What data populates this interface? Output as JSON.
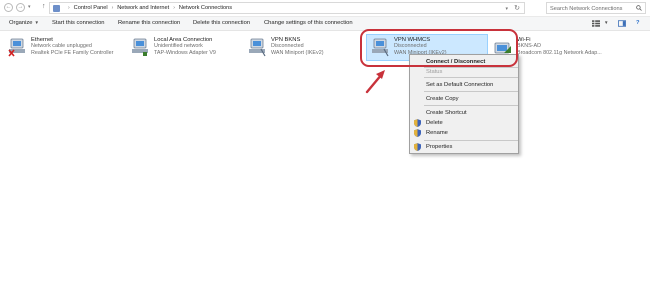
{
  "address_bar": {
    "breadcrumbs": [
      "Control Panel",
      "Network and Internet",
      "Network Connections"
    ],
    "search_placeholder": "Search Network Connections"
  },
  "toolbar": {
    "organize": "Organize",
    "start": "Start this connection",
    "rename": "Rename this connection",
    "delete": "Delete this connection",
    "settings": "Change settings of this connection"
  },
  "connections": [
    {
      "name": "Ethernet",
      "status": "Network cable unplugged",
      "device": "Realtek PCIe FE Family Controller"
    },
    {
      "name": "Local Area Connection",
      "status": "Unidentified network",
      "device": "TAP-Windows Adapter V9"
    },
    {
      "name": "VPN BKNS",
      "status": "Disconnected",
      "device": "WAN Miniport (IKEv2)"
    },
    {
      "name": "VPN WHMCS",
      "status": "Disconnected",
      "device": "WAN Miniport (IKEv2)"
    },
    {
      "name": "Wi-Fi",
      "status": "BKNS-AD",
      "device": "Broadcom 802.11g Network Adap..."
    }
  ],
  "context_menu": {
    "connect": "Connect / Disconnect",
    "status": "Status",
    "set_default": "Set as Default Connection",
    "create_copy": "Create Copy",
    "create_shortcut": "Create Shortcut",
    "delete": "Delete",
    "rename": "Rename",
    "properties": "Properties"
  },
  "colors": {
    "selection": "#cce8ff",
    "annotation": "#c8323b",
    "menu_bg": "#f0f0f0"
  }
}
